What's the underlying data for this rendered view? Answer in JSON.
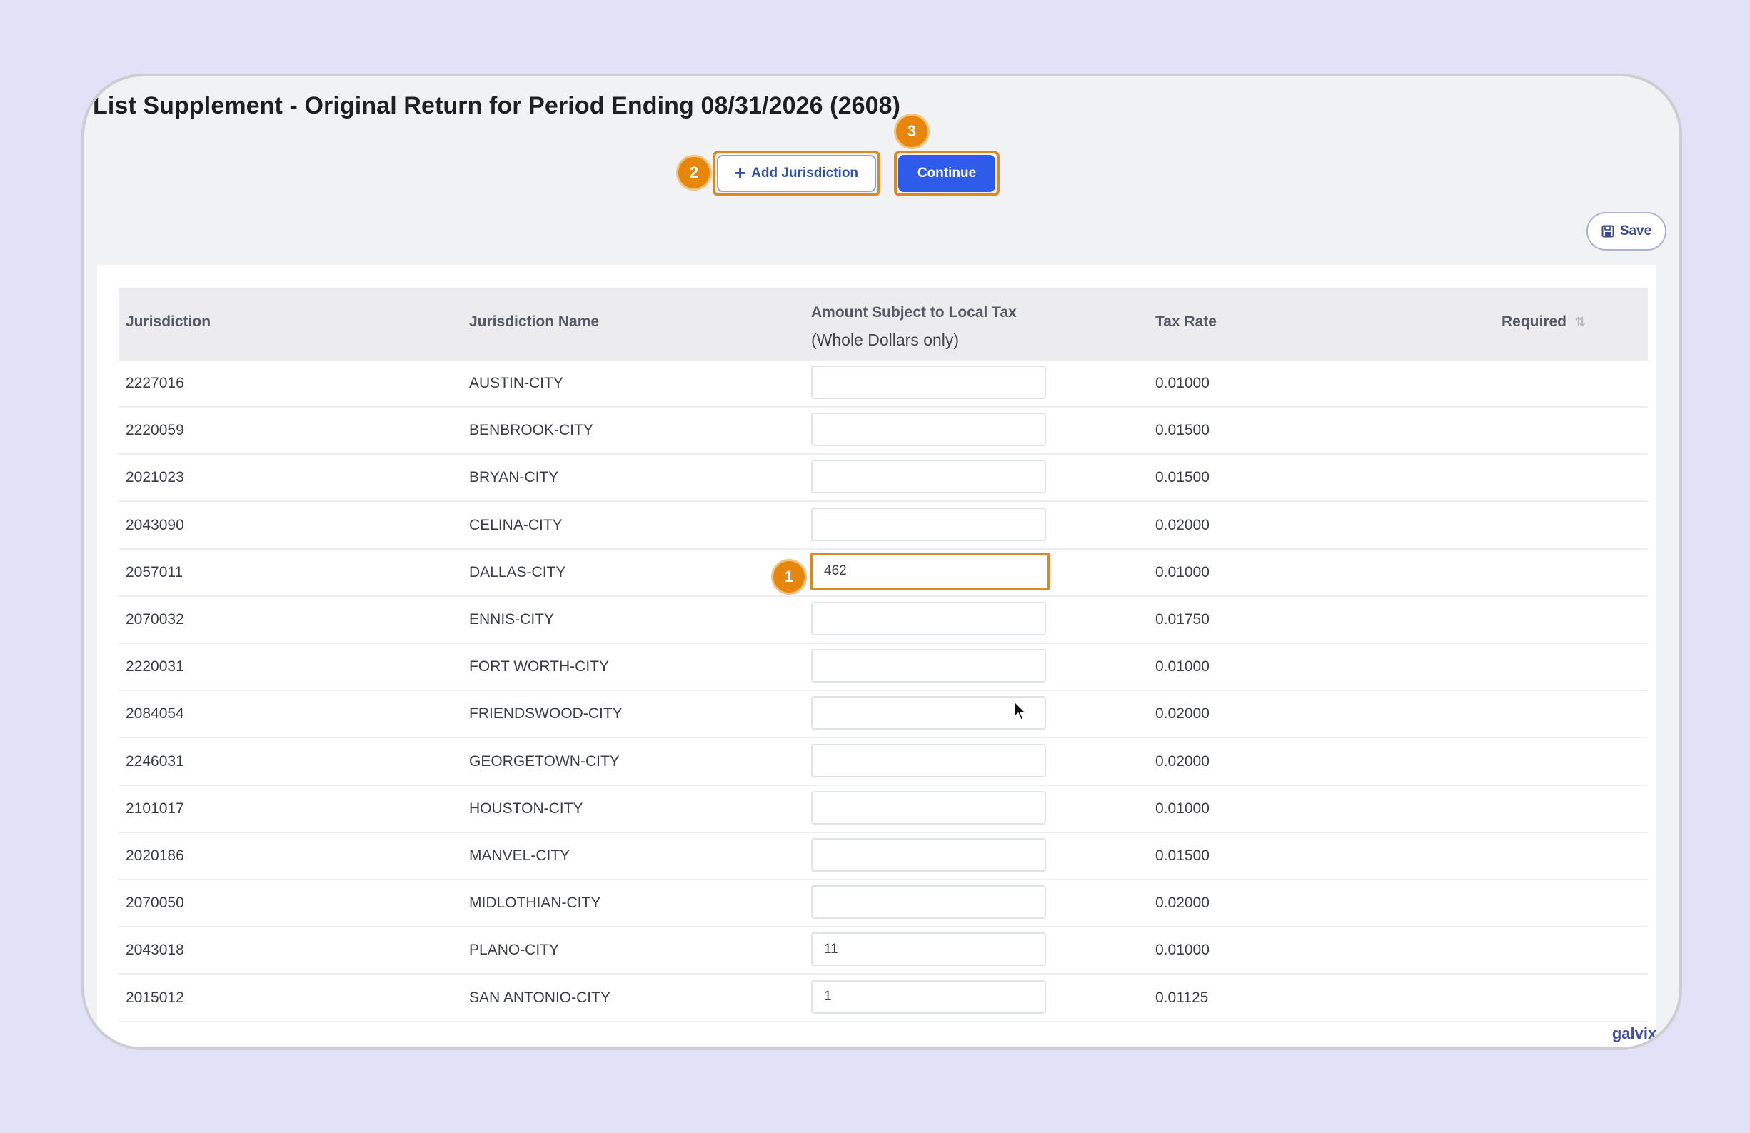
{
  "page": {
    "title": "List Supplement - Original Return for Period Ending 08/31/2026 (2608)"
  },
  "toolbar": {
    "add_jurisdiction_label": "Add Jurisdiction",
    "continue_label": "Continue",
    "save_label": "Save"
  },
  "badges": {
    "one": "1",
    "two": "2",
    "three": "3"
  },
  "table": {
    "headers": {
      "jurisdiction": "Jurisdiction",
      "jurisdiction_name": "Jurisdiction Name",
      "amount_line1": "Amount Subject to Local Tax",
      "amount_line2": "(Whole Dollars only)",
      "tax_rate": "Tax Rate",
      "required": "Required"
    },
    "rows": [
      {
        "code": "2227016",
        "name": "AUSTIN-CITY",
        "amount": "",
        "rate": "0.01000"
      },
      {
        "code": "2220059",
        "name": "BENBROOK-CITY",
        "amount": "",
        "rate": "0.01500"
      },
      {
        "code": "2021023",
        "name": "BRYAN-CITY",
        "amount": "",
        "rate": "0.01500"
      },
      {
        "code": "2043090",
        "name": "CELINA-CITY",
        "amount": "",
        "rate": "0.02000"
      },
      {
        "code": "2057011",
        "name": "DALLAS-CITY",
        "amount": "462",
        "rate": "0.01000"
      },
      {
        "code": "2070032",
        "name": "ENNIS-CITY",
        "amount": "",
        "rate": "0.01750"
      },
      {
        "code": "2220031",
        "name": "FORT WORTH-CITY",
        "amount": "",
        "rate": "0.01000"
      },
      {
        "code": "2084054",
        "name": "FRIENDSWOOD-CITY",
        "amount": "",
        "rate": "0.02000"
      },
      {
        "code": "2246031",
        "name": "GEORGETOWN-CITY",
        "amount": "",
        "rate": "0.02000"
      },
      {
        "code": "2101017",
        "name": "HOUSTON-CITY",
        "amount": "",
        "rate": "0.01000"
      },
      {
        "code": "2020186",
        "name": "MANVEL-CITY",
        "amount": "",
        "rate": "0.01500"
      },
      {
        "code": "2070050",
        "name": "MIDLOTHIAN-CITY",
        "amount": "",
        "rate": "0.02000"
      },
      {
        "code": "2043018",
        "name": "PLANO-CITY",
        "amount": "11",
        "rate": "0.01000"
      },
      {
        "code": "2015012",
        "name": "SAN ANTONIO-CITY",
        "amount": "1",
        "rate": "0.01125"
      }
    ]
  },
  "watermark": "galvix.co",
  "icons": {
    "add": "plus-icon",
    "save": "floppy-disk-icon",
    "sort": "sort-arrows-icon",
    "cursor": "mouse-pointer-icon"
  },
  "colors": {
    "background": "#e1e1f8",
    "primary_button": "#2f5bea",
    "highlight": "#d9882a",
    "badge": "#e6860d"
  }
}
